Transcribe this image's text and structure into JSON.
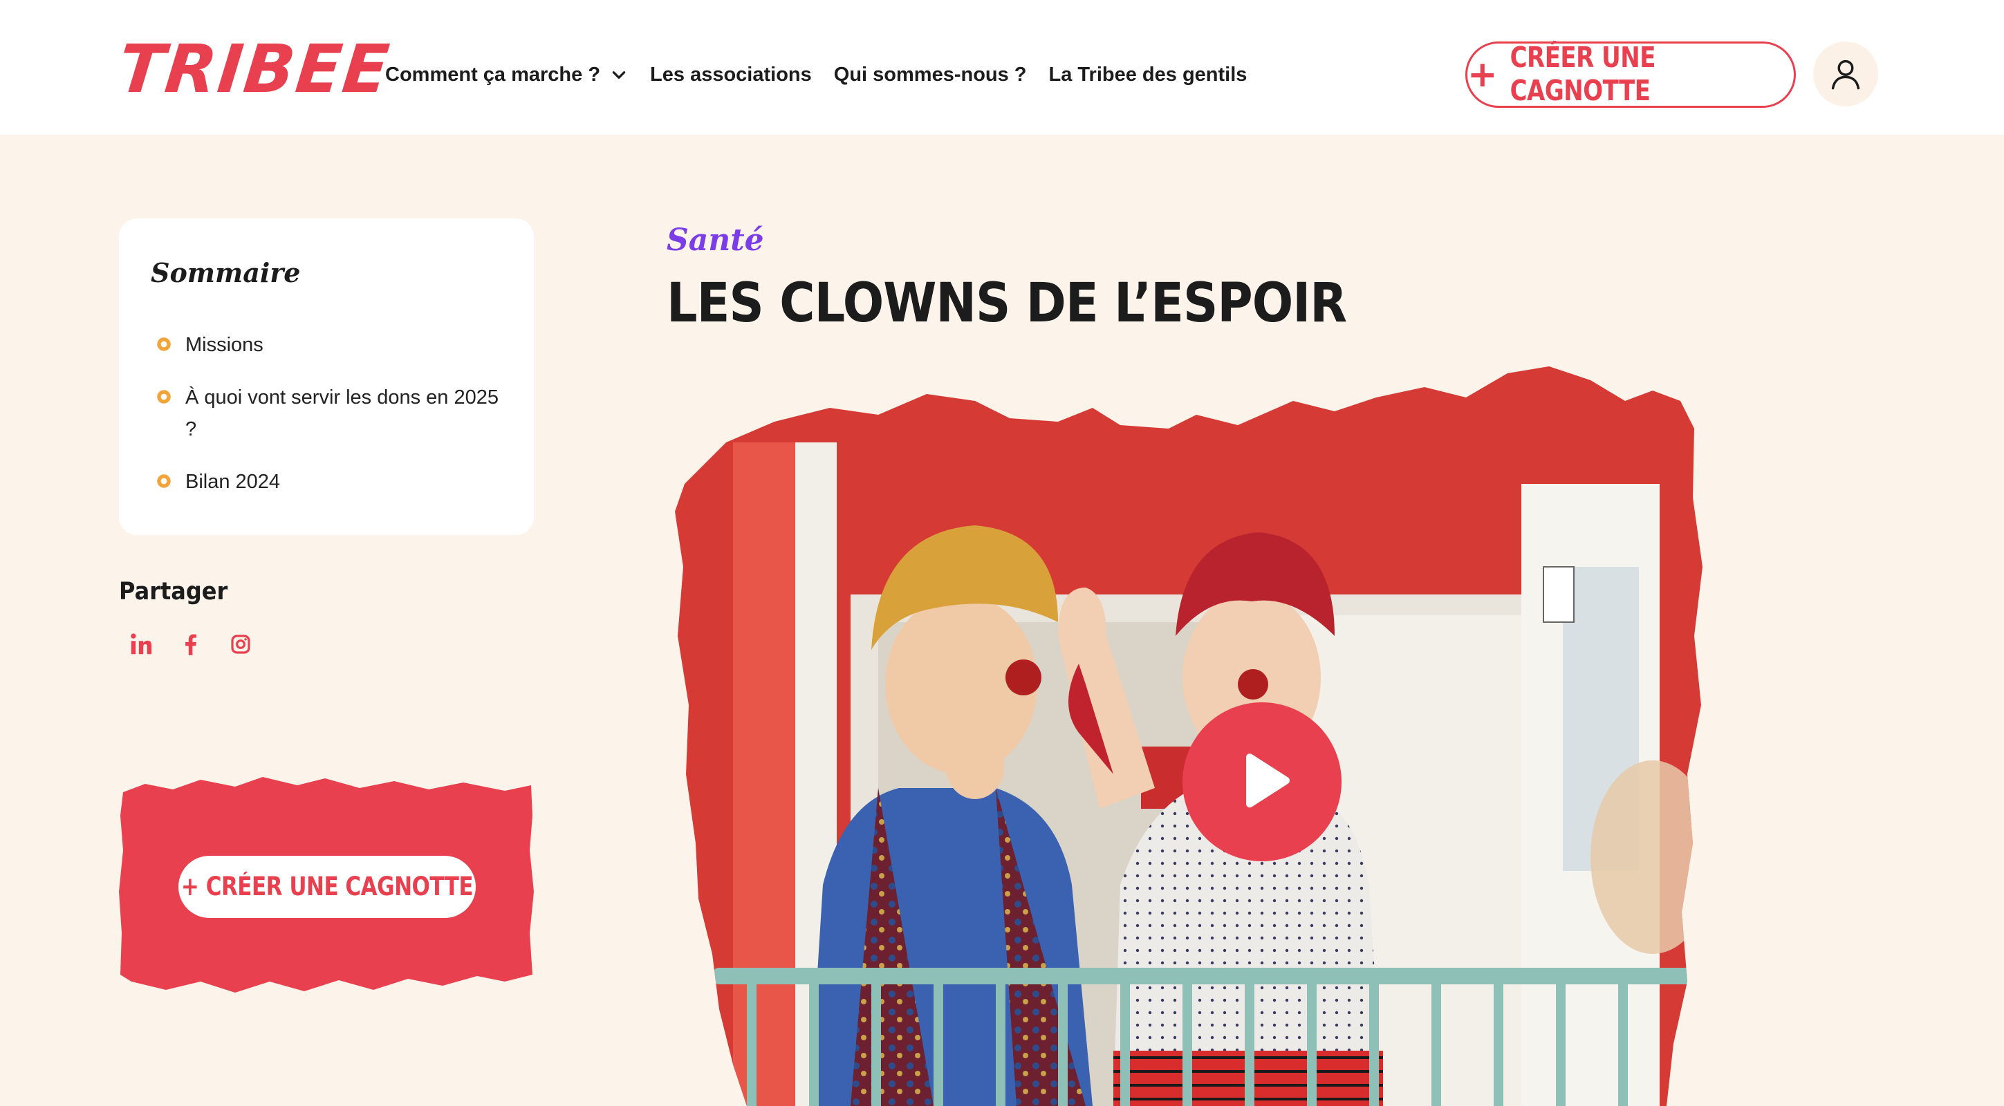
{
  "brand": {
    "logo_text": "TRIBEE",
    "accent": "#e8404f",
    "category_color": "#7a3de8",
    "background": "#fcf3ea"
  },
  "nav": {
    "items": [
      {
        "label": "Comment ça marche ?"
      },
      {
        "label": "Les associations"
      },
      {
        "label": "Qui sommes-nous ?"
      },
      {
        "label": "La Tribee des gentils"
      }
    ],
    "create_button": {
      "icon": "plus-icon",
      "label": "CRÉER UNE CAGNOTTE"
    },
    "account_icon": "user-icon"
  },
  "summary": {
    "title": "Sommaire",
    "items": [
      {
        "label": "Missions"
      },
      {
        "label": "À quoi vont servir les dons en 2025 ?"
      },
      {
        "label": "Bilan 2024"
      }
    ]
  },
  "share": {
    "title": "Partager",
    "icons": [
      "linkedin-icon",
      "facebook-icon",
      "instagram-icon"
    ]
  },
  "cta": {
    "label": "+ CRÉER UNE CAGNOTTE"
  },
  "article": {
    "category": "Santé",
    "title": "LES CLOWNS DE L’ESPOIR",
    "video": {
      "play_icon": "play-icon"
    }
  }
}
